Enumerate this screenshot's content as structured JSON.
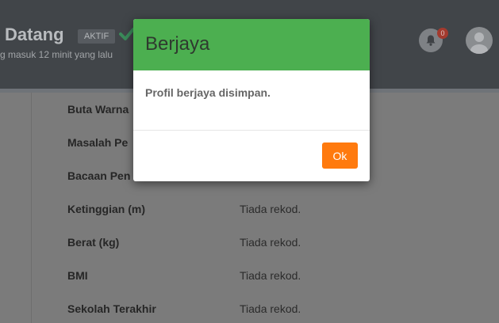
{
  "header": {
    "welcome": "Datang",
    "status_badge": "AKTIF",
    "last_login": "g masuk 12 minit yang lalu",
    "notifications_count": "0"
  },
  "profile": {
    "rows": [
      {
        "label": "Buta Warna",
        "value": ""
      },
      {
        "label": "Masalah Pe",
        "value": ""
      },
      {
        "label": "Bacaan Pen",
        "value": ""
      },
      {
        "label": "Ketinggian (m)",
        "value": "Tiada rekod."
      },
      {
        "label": "Berat (kg)",
        "value": "Tiada rekod."
      },
      {
        "label": "BMI",
        "value": "Tiada rekod."
      },
      {
        "label": "Sekolah Terakhir",
        "value": "Tiada rekod."
      }
    ]
  },
  "modal": {
    "title": "Berjaya",
    "message": "Profil berjaya disimpan.",
    "ok_label": "Ok",
    "header_color": "#4caf50",
    "ok_color": "#ff7a0e"
  },
  "icons": {
    "check": "check-icon",
    "bell": "bell-icon",
    "avatar": "user-avatar-icon"
  }
}
